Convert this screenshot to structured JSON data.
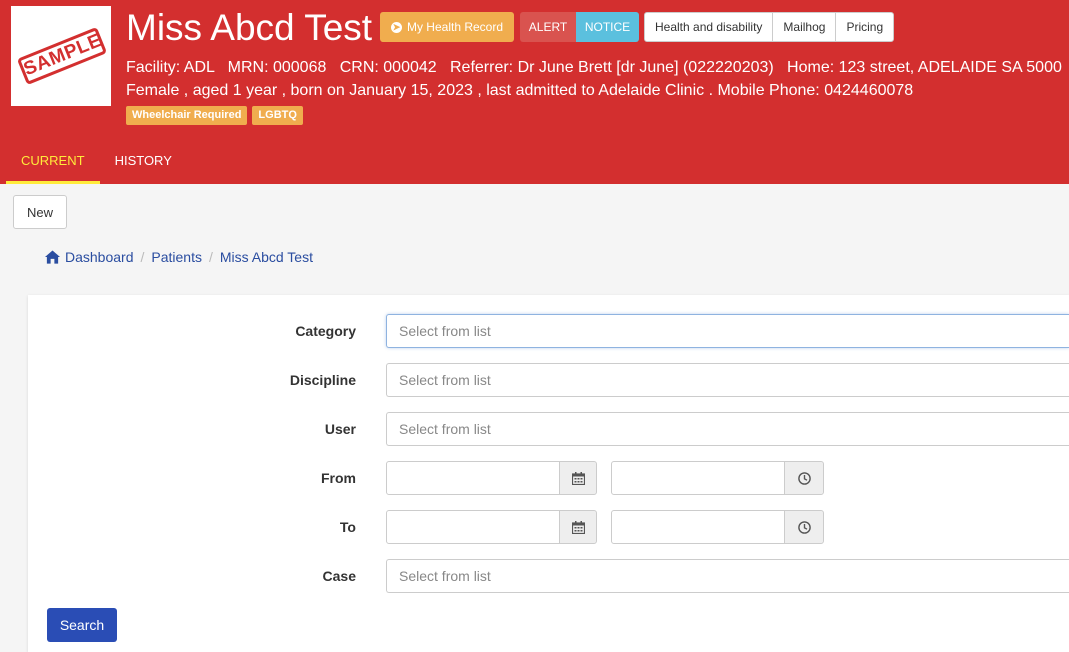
{
  "patient": {
    "name": "Miss Abcd Test",
    "photo_stamp": "SAMPLE",
    "info_line1": "Facility: ADL   MRN: 000068   CRN: 000042   Referrer: Dr June Brett [dr June] (022220203)   Home: 123 street, ADELAIDE SA 5000",
    "info_line2": "Female , aged 1 year , born on January 15, 2023 , last admitted to Adelaide Clinic . Mobile Phone: 0424460078",
    "tags": [
      "Wheelchair Required",
      "LGBTQ"
    ]
  },
  "header_buttons": {
    "my_health_record": "My Health Record",
    "alert": "ALERT",
    "notice": "NOTICE",
    "links": [
      "Health and disability",
      "Mailhog",
      "Pricing"
    ]
  },
  "tabs": [
    "CURRENT",
    "HISTORY"
  ],
  "toolbar": {
    "new_label": "New"
  },
  "breadcrumb": [
    "Dashboard",
    "Patients",
    "Miss Abcd Test"
  ],
  "form": {
    "category_label": "Category",
    "discipline_label": "Discipline",
    "user_label": "User",
    "from_label": "From",
    "to_label": "To",
    "case_label": "Case",
    "select_placeholder": "Select from list",
    "search_label": "Search"
  },
  "colors": {
    "header_bg": "#d32f2f",
    "accent_warning": "#f0ad4e",
    "alert": "#d9534f",
    "notice": "#5bc0de",
    "primary": "#2a4db5",
    "active_tab": "#ffeb3b"
  }
}
